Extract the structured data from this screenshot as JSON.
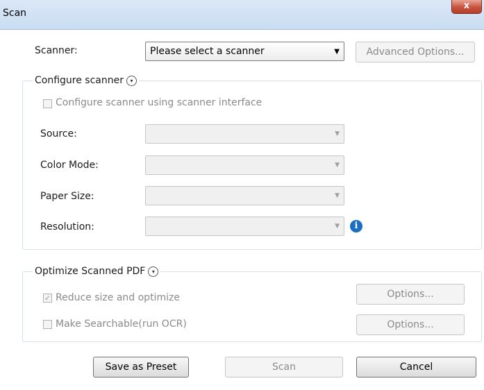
{
  "window": {
    "title": "Scan",
    "close_label": "x"
  },
  "scanner": {
    "label": "Scanner:",
    "selected": "Please select a scanner",
    "advanced_options": "Advanced Options..."
  },
  "configure": {
    "title": "Configure scanner",
    "use_interface_label": "Configure scanner using scanner interface",
    "use_interface_checked": false,
    "source_label": "Source:",
    "source_value": "",
    "color_mode_label": "Color Mode:",
    "color_mode_value": "",
    "paper_size_label": "Paper Size:",
    "paper_size_value": "",
    "resolution_label": "Resolution:",
    "resolution_value": "",
    "info_icon": "i"
  },
  "optimize": {
    "title": "Optimize Scanned PDF",
    "reduce_label": "Reduce size and optimize",
    "reduce_checked": true,
    "reduce_options": "Options...",
    "ocr_label": "Make Searchable(run OCR)",
    "ocr_checked": false,
    "ocr_options": "Options..."
  },
  "footer": {
    "save_preset": "Save as Preset",
    "scan": "Scan",
    "cancel": "Cancel"
  },
  "glyphs": {
    "dropdown_arrow": "▼",
    "chevron_down": "▾",
    "check": "✓"
  },
  "colors": {
    "accent": "#1a6fc2",
    "close_red": "#c8533d",
    "titlebar": "#d3e3f5"
  }
}
